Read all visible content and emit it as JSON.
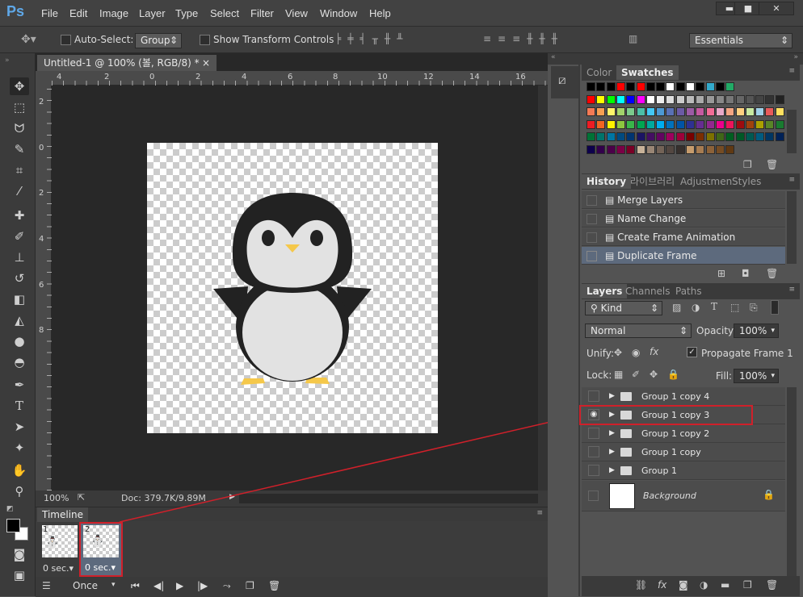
{
  "app": {
    "logo": "Ps"
  },
  "menu": [
    "File",
    "Edit",
    "Image",
    "Layer",
    "Type",
    "Select",
    "Filter",
    "View",
    "Window",
    "Help"
  ],
  "window_controls": {
    "minimize": "▬",
    "maximize": "■",
    "close": "✕"
  },
  "options": {
    "auto_select_label": "Auto-Select:",
    "auto_select_value": "Group",
    "show_transform_label": "Show Transform Controls",
    "workspace": "Essentials"
  },
  "document": {
    "tab_title": "Untitled-1 @ 100% (볼, RGB/8) *",
    "close": "×",
    "ruler_h": [
      "4",
      "2",
      "0",
      "2",
      "4",
      "6",
      "8",
      "10",
      "12",
      "14",
      "16"
    ],
    "ruler_v": [
      "2",
      "0",
      "2",
      "4",
      "6",
      "8"
    ],
    "zoom": "100%",
    "doc_info": "Doc: 379.7K/9.89M"
  },
  "timeline": {
    "title": "Timeline",
    "frames": [
      {
        "num": "1",
        "delay": "0 sec.▾"
      },
      {
        "num": "2",
        "delay": "0 sec.▾"
      }
    ],
    "loop": "Once"
  },
  "color_panel": {
    "tabs": [
      "Color",
      "Swatches"
    ],
    "active": "Swatches"
  },
  "history_panel": {
    "tabs": [
      "History",
      "라이브러리",
      "Adjustmen",
      "Styles"
    ],
    "items": [
      "Merge Layers",
      "Name Change",
      "Create Frame Animation",
      "Duplicate Frame"
    ],
    "selected_index": 3
  },
  "layers_panel": {
    "tabs": [
      "Layers",
      "Channels",
      "Paths"
    ],
    "kind": "Kind",
    "blend": "Normal",
    "opacity_label": "Opacity:",
    "opacity": "100%",
    "unify_label": "Unify:",
    "propagate_label": "Propagate Frame 1",
    "lock_label": "Lock:",
    "fill_label": "Fill:",
    "fill": "100%",
    "layers": [
      {
        "name": "Group 1 copy 4",
        "visible": false
      },
      {
        "name": "Group 1 copy 3",
        "visible": true
      },
      {
        "name": "Group 1 copy 2",
        "visible": false
      },
      {
        "name": "Group 1 copy",
        "visible": false
      },
      {
        "name": "Group 1",
        "visible": false
      }
    ],
    "background": "Background"
  },
  "colors": {
    "highlight_red": "#d0202a",
    "selected_history": "#5d6a7d",
    "ps_blue": "#5fa8e8"
  }
}
